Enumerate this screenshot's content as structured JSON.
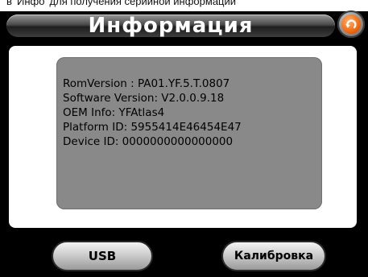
{
  "caption": "в 'Инфо' для получения серийной информации",
  "header": {
    "title": "Информация"
  },
  "info": {
    "lines": [
      "RomVersion : PA01.YF.5.T.0807",
      "Software Version: V2.0.0.9.18",
      "OEM Info: YFAtlas4",
      "Platform ID: 5955414E46454E47",
      "Device ID: 0000000000000000"
    ]
  },
  "buttons": {
    "usb_label": "USB",
    "calibration_label": "Калибровка"
  },
  "colors": {
    "back_button_accent": "#f06a10",
    "info_box_bg": "#898989"
  }
}
